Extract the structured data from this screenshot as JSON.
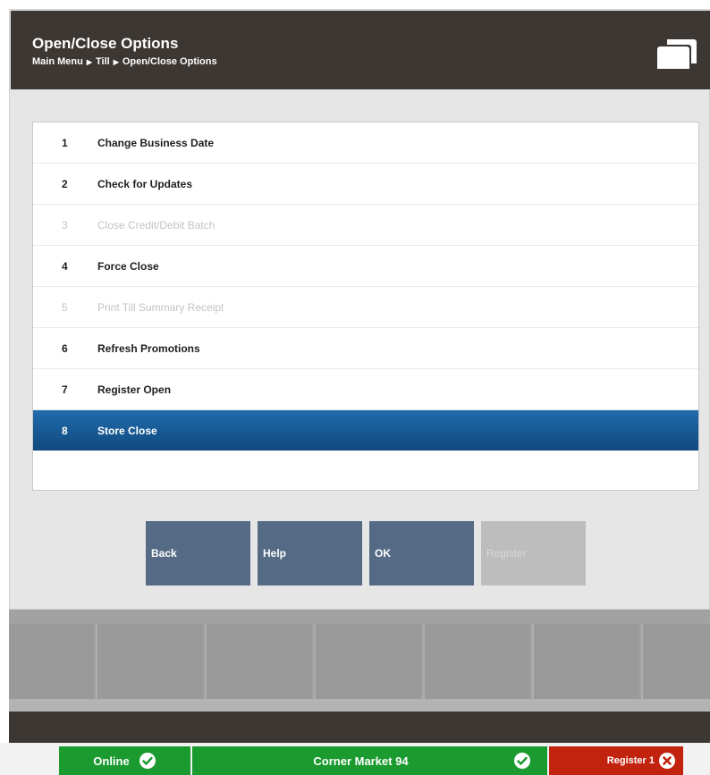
{
  "header": {
    "title": "Open/Close Options",
    "breadcrumb": [
      "Main Menu",
      "Till",
      "Open/Close Options"
    ],
    "separator": "▶"
  },
  "menu": {
    "items": [
      {
        "number": "1",
        "label": "Change Business Date",
        "enabled": true,
        "selected": false
      },
      {
        "number": "2",
        "label": "Check for Updates",
        "enabled": true,
        "selected": false
      },
      {
        "number": "3",
        "label": "Close Credit/Debit Batch",
        "enabled": false,
        "selected": false
      },
      {
        "number": "4",
        "label": "Force Close",
        "enabled": true,
        "selected": false
      },
      {
        "number": "5",
        "label": "Print Till Summary Receipt",
        "enabled": false,
        "selected": false
      },
      {
        "number": "6",
        "label": "Refresh Promotions",
        "enabled": true,
        "selected": false
      },
      {
        "number": "7",
        "label": "Register Open",
        "enabled": true,
        "selected": false
      },
      {
        "number": "8",
        "label": "Store Close",
        "enabled": true,
        "selected": true
      }
    ]
  },
  "buttons": {
    "back": "Back",
    "help": "Help",
    "ok": "OK",
    "register": "Register"
  },
  "status": {
    "connection": "Online",
    "store": "Corner Market 94",
    "register": "Register 1"
  },
  "colors": {
    "header_bg": "#3c3733",
    "selected_row": "#1f6cae",
    "button_bg": "#556b85",
    "status_green": "#1a9a2f",
    "status_red": "#c1230f"
  }
}
